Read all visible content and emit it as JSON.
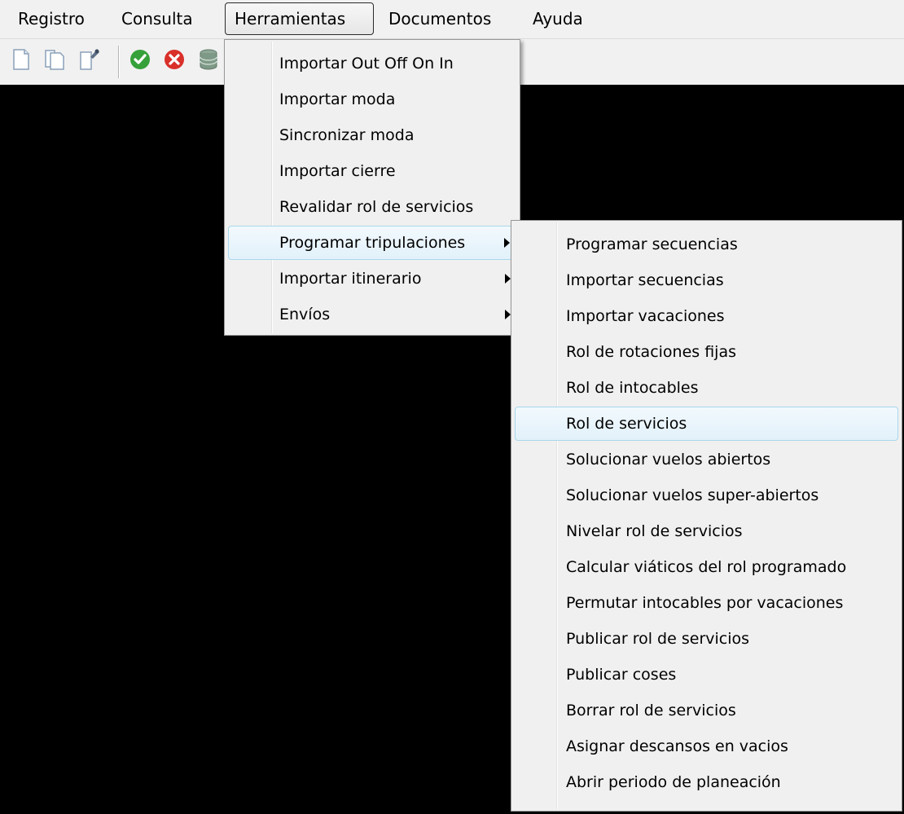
{
  "menubar": {
    "items": [
      {
        "label": "Registro"
      },
      {
        "label": "Consulta"
      },
      {
        "label": "Herramientas"
      },
      {
        "label": "Documentos"
      },
      {
        "label": "Ayuda"
      }
    ]
  },
  "toolbar": {
    "icons": [
      "new-document-icon",
      "copy-document-icon",
      "edit-document-icon",
      "accept-check-icon",
      "cancel-x-icon",
      "database-icon"
    ]
  },
  "herramientas_menu": {
    "items": [
      {
        "label": "Importar Out Off On In"
      },
      {
        "label": "Importar moda"
      },
      {
        "label": "Sincronizar moda"
      },
      {
        "label": "Importar cierre"
      },
      {
        "label": "Revalidar rol de servicios"
      },
      {
        "label": "Programar tripulaciones",
        "submenu": true,
        "highlighted": true
      },
      {
        "label": "Importar itinerario",
        "submenu": true
      },
      {
        "label": "Envíos",
        "submenu": true
      }
    ]
  },
  "programar_submenu": {
    "items": [
      {
        "label": "Programar secuencias"
      },
      {
        "label": "Importar secuencias"
      },
      {
        "label": "Importar vacaciones"
      },
      {
        "label": "Rol de rotaciones fijas"
      },
      {
        "label": "Rol de intocables"
      },
      {
        "label": "Rol de servicios",
        "highlighted": true
      },
      {
        "label": "Solucionar vuelos abiertos"
      },
      {
        "label": "Solucionar vuelos super-abiertos"
      },
      {
        "label": "Nivelar rol de servicios"
      },
      {
        "label": "Calcular viáticos del rol programado"
      },
      {
        "label": "Permutar intocables por vacaciones"
      },
      {
        "label": "Publicar rol de servicios"
      },
      {
        "label": "Publicar coses"
      },
      {
        "label": "Borrar rol de servicios"
      },
      {
        "label": "Asignar descansos en vacios"
      },
      {
        "label": "Abrir periodo de planeación"
      }
    ]
  },
  "colors": {
    "workspace": "#000000",
    "menu_bg": "#f0f0f0",
    "highlight_border": "#a8d8eb",
    "highlight_bg": "#e2f1fa"
  }
}
